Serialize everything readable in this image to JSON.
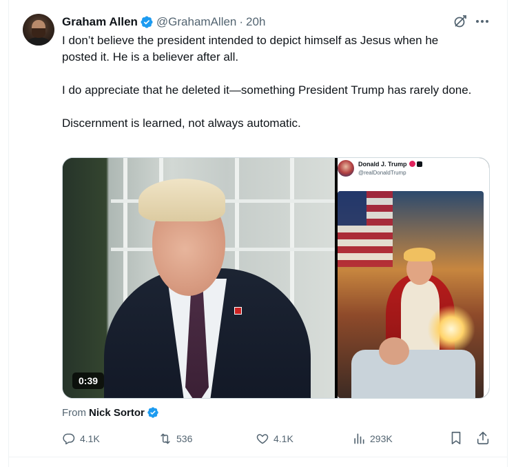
{
  "tweet": {
    "author": {
      "display_name": "Graham Allen",
      "handle": "@GrahamAllen",
      "separator": "·",
      "time": "20h",
      "verified": true
    },
    "text": {
      "paragraphs": [
        "I don’t believe the president intended to depict himself as Jesus when he posted it. He is a believer after all.",
        "I do appreciate that he deleted it—something President Trump has rarely done.",
        "Discernment is learned, not always automatic."
      ]
    },
    "media": {
      "video_duration": "0:39",
      "embedded_post": {
        "name": "Donald J. Trump",
        "handle": "@realDonaldTrump"
      }
    },
    "attribution": {
      "prefix": "From",
      "name": "Nick Sortor"
    },
    "actions": {
      "replies": "4.1K",
      "reposts": "536",
      "likes": "4.1K",
      "views": "293K"
    },
    "icons": {
      "verified": "verified-badge-icon",
      "grok": "grok-icon",
      "more": "more-icon",
      "reply": "reply-icon",
      "repost": "repost-icon",
      "like": "heart-icon",
      "views": "views-chart-icon",
      "bookmark": "bookmark-icon",
      "share": "share-icon"
    },
    "colors": {
      "verified_blue": "#1d9bf0",
      "text_primary": "#0f1419",
      "text_secondary": "#536471"
    }
  }
}
